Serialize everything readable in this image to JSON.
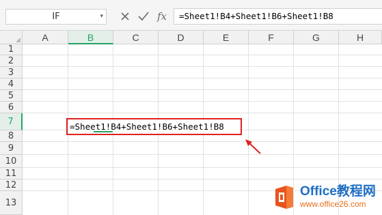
{
  "formula_bar": {
    "name_box": "IF",
    "cancel_icon": "close-icon",
    "confirm_icon": "check-icon",
    "fx_label": "fx",
    "formula": "=Sheet1!B4+Sheet1!B6+Sheet1!B8"
  },
  "columns": [
    "A",
    "B",
    "C",
    "D",
    "E",
    "F",
    "G",
    "H"
  ],
  "active_column": "B",
  "rows": [
    "1",
    "2",
    "3",
    "4",
    "5",
    "6",
    "7",
    "8",
    "9",
    "10",
    "11",
    "12",
    "13"
  ],
  "active_row": "7",
  "editing_cell": {
    "ref": "B7",
    "content": "=Sheet1!B4+Sheet1!B6+Sheet1!B8"
  },
  "annotation": {
    "box_color": "#e02020",
    "arrow_icon": "red-arrow-icon"
  },
  "watermark": {
    "title_prefix": "Office",
    "title_suffix": "教程网",
    "url": "www.office26.com",
    "title_color": "#1f6fc4",
    "url_color": "#e96d1a"
  },
  "colors": {
    "accent": "#21a366",
    "highlight": "#e02020"
  }
}
